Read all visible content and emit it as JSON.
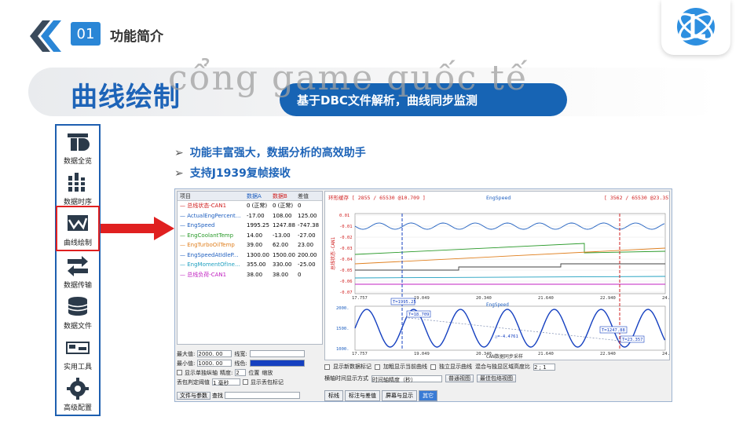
{
  "header": {
    "section_number": "01",
    "section_title": "功能简介"
  },
  "banner": {
    "title": "曲线绘制",
    "subtitle": "基于DBC文件解析，曲线同步监测",
    "watermark": "cổng game quốc tế"
  },
  "sidebar": {
    "items": [
      {
        "label": "数据全览",
        "icon": "overview-icon"
      },
      {
        "label": "数据时序",
        "icon": "timeline-icon"
      },
      {
        "label": "曲线绘制",
        "icon": "curve-icon"
      },
      {
        "label": "数据传输",
        "icon": "transfer-icon"
      },
      {
        "label": "数据文件",
        "icon": "database-icon"
      },
      {
        "label": "实用工具",
        "icon": "tools-icon"
      },
      {
        "label": "高级配置",
        "icon": "gear-icon"
      }
    ]
  },
  "bullets": [
    "功能丰富强大，数据分析的高效助手",
    "支持J1939复帧接收"
  ],
  "app": {
    "table_headers": [
      "项目",
      "数据A",
      "数据B",
      "差值"
    ],
    "signals": [
      {
        "name": "总线状态-CAN1",
        "a": "0 (正常)",
        "b": "0 (正常)",
        "diff": "0",
        "color": "#d02020"
      },
      {
        "name": "ActualEngPercent...",
        "a": "-17.00",
        "b": "108.00",
        "diff": "125.00",
        "color": "#2060c0"
      },
      {
        "name": "EngSpeed",
        "a": "1995.25",
        "b": "1247.88",
        "diff": "-747.38",
        "color": "#2060c0"
      },
      {
        "name": "EngCoolantTemp",
        "a": "14.00",
        "b": "-13.00",
        "diff": "-27.00",
        "color": "#2a9a2a"
      },
      {
        "name": "EngTurboOilTemp",
        "a": "39.00",
        "b": "62.00",
        "diff": "23.00",
        "color": "#e08020"
      },
      {
        "name": "EngSpeedAtIdleP...",
        "a": "1300.00",
        "b": "1500.00",
        "diff": "200.00",
        "color": "#2060c0"
      },
      {
        "name": "EngMomentOfIne...",
        "a": "355.00",
        "b": "330.00",
        "diff": "-25.00",
        "color": "#20a0c0"
      },
      {
        "name": "总线负荷-CAN1",
        "a": "38.00",
        "b": "38.00",
        "diff": "0",
        "color": "#c020c0"
      }
    ],
    "controls": {
      "max_label": "最大值:",
      "max_value": "2000. 00",
      "min_label": "最小值:",
      "min_value": "1000. 00",
      "line_width_label": "线宽:",
      "line_color_label": "线色:",
      "show_single_axis": "显示单独纵轴",
      "precision_label": "精度:",
      "precision_value": "2",
      "position_label": "位置",
      "zoom_label": "缩放",
      "filter_label": "丢包判定阈值",
      "filter_value": "1 毫秒",
      "show_lost_label": "显示丢包标记",
      "filter_param": "文件与参数",
      "search": "查找"
    },
    "chart": {
      "header_left": "环形缓存 [ 2855 / 65530 @10.709 ]",
      "header_title": "EngSpeed",
      "header_right": "[ 3562 / 65530 @23.357 ]",
      "top_ylabel": "总线状态-CAN1",
      "top_yticks": [
        "0.01",
        "-0.01",
        "-0.02",
        "-0.03",
        "-0.04",
        "-0.05",
        "-0.06",
        "-0.07"
      ],
      "xticks": [
        "17.757",
        "19.049",
        "20.340",
        "21.640",
        "22.940",
        "24.237"
      ],
      "bottom_title": "EngSpeed",
      "bottom_yticks": [
        "2000.",
        "1500.",
        "1000."
      ],
      "bottom_xlabel": "CAN数据同步采样",
      "labels": [
        "T=1995.25",
        "T=18.709",
        "△=-4.4761",
        "T=1247.88",
        "T=23.357"
      ]
    },
    "bottom": {
      "show_new_marker": "显示新数据标记",
      "locate_curve": "加粗显示当前曲线",
      "independent_curve": "独立显示曲线",
      "mix_ratio_label": "混合与独显区域高度比",
      "ratio": "2 ; 1",
      "time_mode_label": "横轴时间显示方式",
      "time_mode_value": "时间轴精度（秒）",
      "normal_view": "普通视图",
      "best_view": "最佳包络视图"
    },
    "tabs": [
      "标线",
      "标注与差值",
      "屏幕与显示",
      "其它"
    ],
    "active_tab": "其它"
  }
}
